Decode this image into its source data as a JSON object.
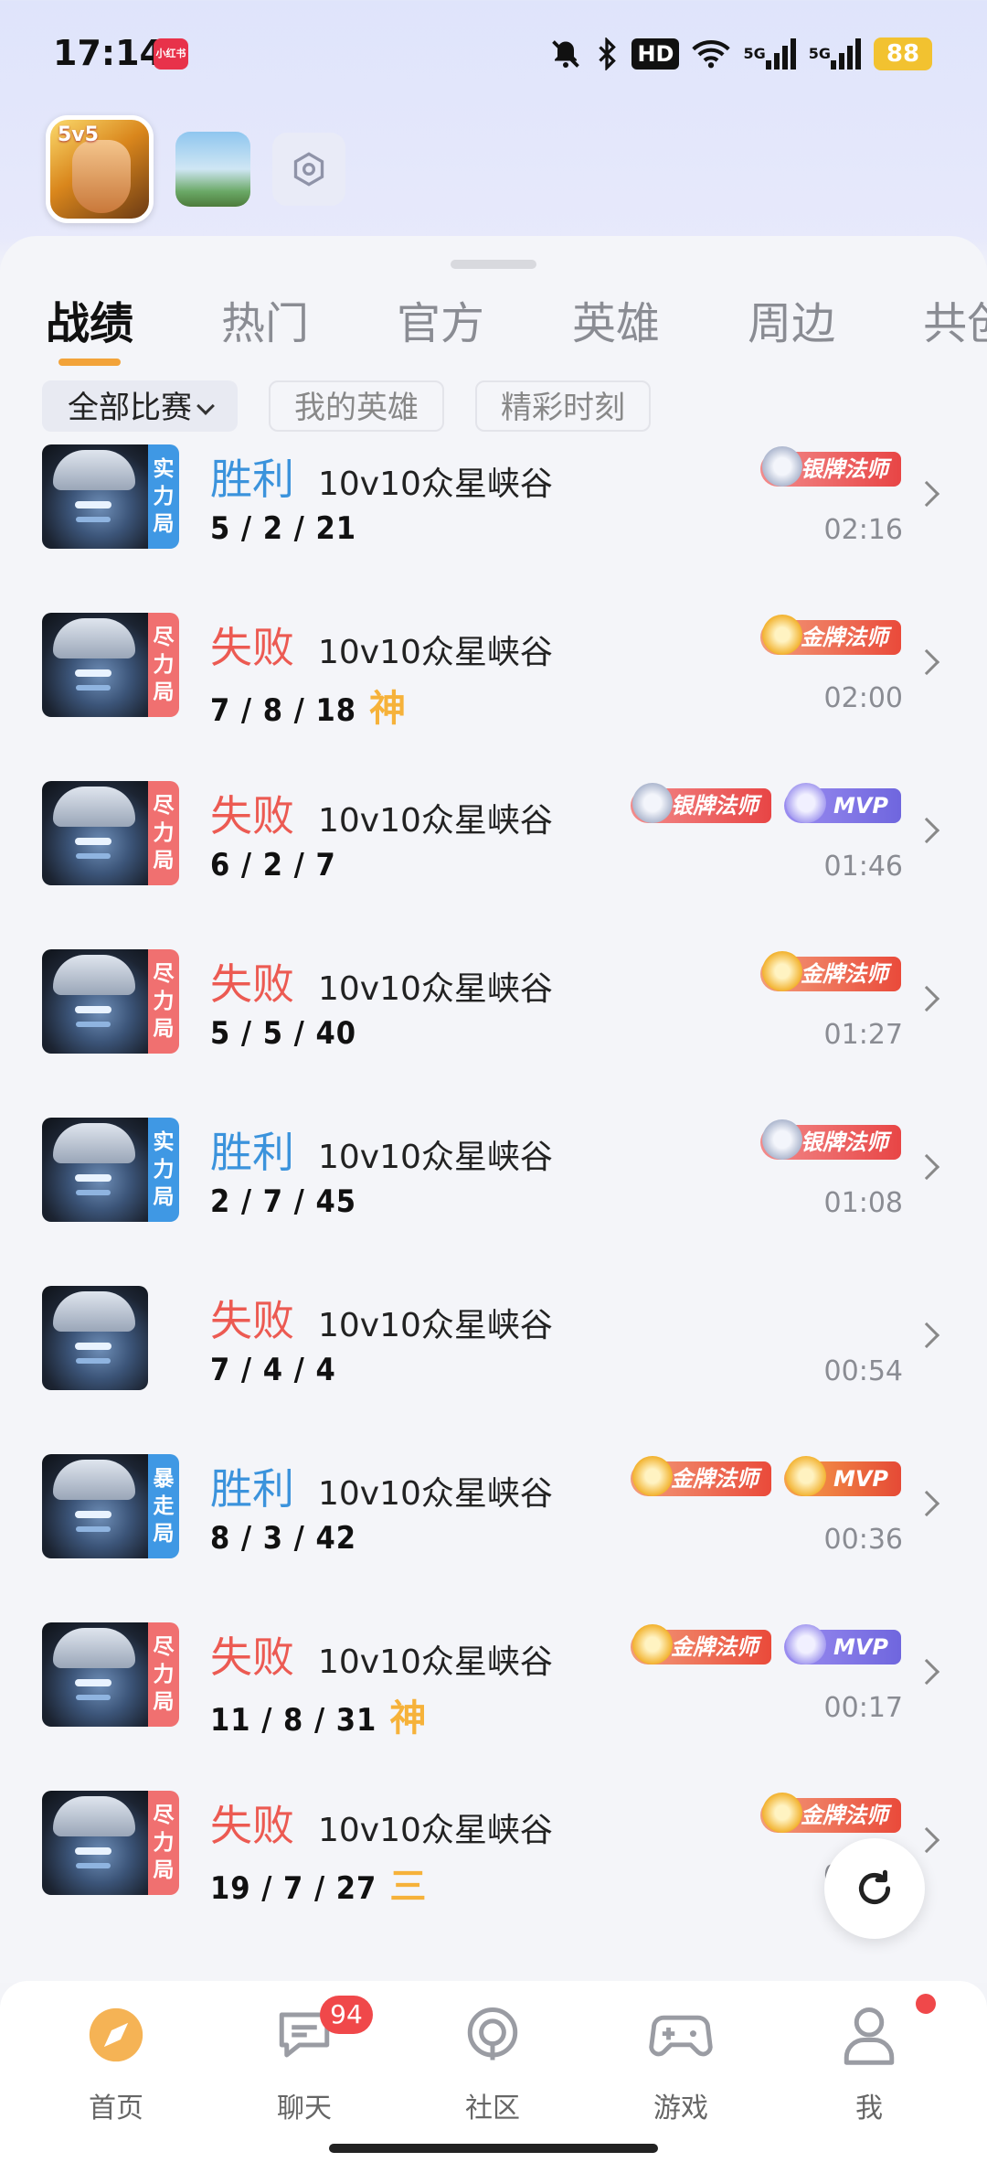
{
  "status_bar": {
    "time": "17:14",
    "app_icon_label": "小红书",
    "hd_label": "HD",
    "net_label_1": "5G",
    "net_label_2": "5G",
    "battery": "88"
  },
  "apps": {
    "main_tag": "5v5"
  },
  "tabs": [
    {
      "label": "战绩",
      "active": true
    },
    {
      "label": "热门"
    },
    {
      "label": "官方"
    },
    {
      "label": "英雄"
    },
    {
      "label": "周边"
    },
    {
      "label": "共创"
    }
  ],
  "filters": [
    {
      "label": "全部比赛",
      "active": true
    },
    {
      "label": "我的英雄"
    },
    {
      "label": "精彩时刻"
    }
  ],
  "matches": [
    {
      "mode": "实力局",
      "mode_color": "#3f98e4",
      "result": "胜利",
      "win": true,
      "map": "10v10众星峡谷",
      "kda": "5 / 2 / 21",
      "honor": "",
      "badges": [
        {
          "type": "silver",
          "label": "银牌法师"
        }
      ],
      "time": "02:16"
    },
    {
      "mode": "尽力局",
      "mode_color": "#f07070",
      "result": "失败",
      "win": false,
      "map": "10v10众星峡谷",
      "kda": "7 / 8 / 18",
      "honor": "神",
      "badges": [
        {
          "type": "gold",
          "label": "金牌法师"
        }
      ],
      "time": "02:00"
    },
    {
      "mode": "尽力局",
      "mode_color": "#f07070",
      "result": "失败",
      "win": false,
      "map": "10v10众星峡谷",
      "kda": "6 / 2 / 7",
      "honor": "",
      "badges": [
        {
          "type": "silver",
          "label": "银牌法师"
        },
        {
          "type": "mvp-silver",
          "label": "MVP"
        }
      ],
      "time": "01:46"
    },
    {
      "mode": "尽力局",
      "mode_color": "#f07070",
      "result": "失败",
      "win": false,
      "map": "10v10众星峡谷",
      "kda": "5 / 5 / 40",
      "honor": "",
      "badges": [
        {
          "type": "gold",
          "label": "金牌法师"
        }
      ],
      "time": "01:27"
    },
    {
      "mode": "实力局",
      "mode_color": "#3f98e4",
      "result": "胜利",
      "win": true,
      "map": "10v10众星峡谷",
      "kda": "2 / 7 / 45",
      "honor": "",
      "badges": [
        {
          "type": "silver",
          "label": "银牌法师"
        }
      ],
      "time": "01:08"
    },
    {
      "mode": "",
      "mode_color": "",
      "result": "失败",
      "win": false,
      "map": "10v10众星峡谷",
      "kda": "7 / 4 / 4",
      "honor": "",
      "badges": [],
      "time": "00:54"
    },
    {
      "mode": "暴走局",
      "mode_color": "#3f98e4",
      "result": "胜利",
      "win": true,
      "map": "10v10众星峡谷",
      "kda": "8 / 3 / 42",
      "honor": "",
      "badges": [
        {
          "type": "gold",
          "label": "金牌法师"
        },
        {
          "type": "mvp-gold",
          "label": "MVP"
        }
      ],
      "time": "00:36"
    },
    {
      "mode": "尽力局",
      "mode_color": "#f07070",
      "result": "失败",
      "win": false,
      "map": "10v10众星峡谷",
      "kda": "11 / 8 / 31",
      "honor": "神",
      "badges": [
        {
          "type": "gold",
          "label": "金牌法师"
        },
        {
          "type": "mvp-silver",
          "label": "MVP"
        }
      ],
      "time": "00:17"
    },
    {
      "mode": "尽力局",
      "mode_color": "#f07070",
      "result": "失败",
      "win": false,
      "map": "10v10众星峡谷",
      "kda": "19 / 7 / 27",
      "honor": "三",
      "badges": [
        {
          "type": "gold",
          "label": "金牌法师"
        }
      ],
      "time": "02-03"
    }
  ],
  "bottom_nav": [
    {
      "label": "首页",
      "icon": "compass-icon",
      "active": true
    },
    {
      "label": "聊天",
      "icon": "chat-icon",
      "badge": "94"
    },
    {
      "label": "社区",
      "icon": "broadcast-icon"
    },
    {
      "label": "游戏",
      "icon": "gamepad-icon"
    },
    {
      "label": "我",
      "icon": "profile-icon",
      "dot": true
    }
  ],
  "colors": {
    "accent": "#f2a33a",
    "win": "#3b93dc",
    "lose": "#ec5a52",
    "badge_red": "#f0484a"
  }
}
